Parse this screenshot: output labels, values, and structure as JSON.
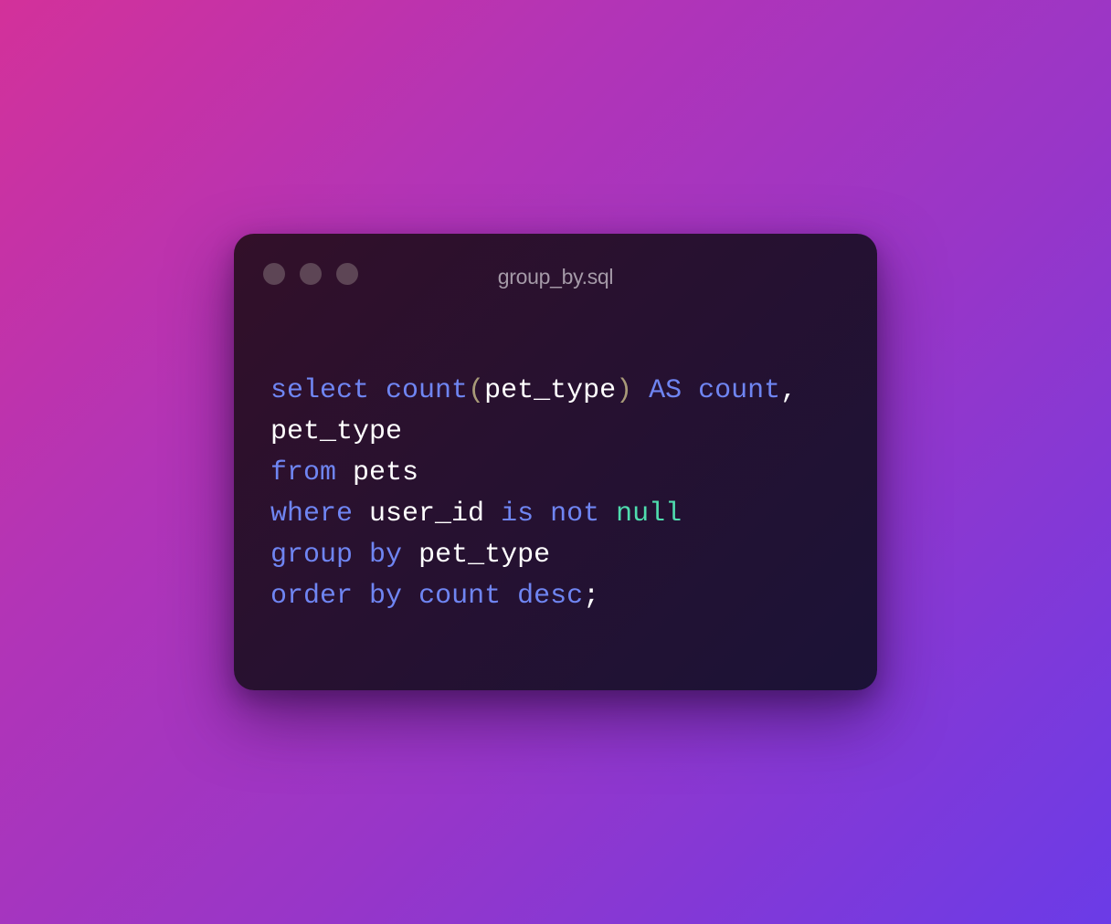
{
  "window": {
    "title": "group_by.sql",
    "traffic_lights": [
      "close-dot",
      "minimize-dot",
      "maximize-dot"
    ]
  },
  "colors": {
    "keyword": "#6f85f2",
    "identifier": "#ffffff",
    "paren": "#a89a78",
    "literal": "#4fdcae",
    "title": "#a59aa8",
    "window_bg": "#271130"
  },
  "code": {
    "lines": [
      [
        {
          "t": "select",
          "k": "kw"
        },
        {
          "t": " ",
          "k": "id"
        },
        {
          "t": "count",
          "k": "fn"
        },
        {
          "t": "(",
          "k": "paren"
        },
        {
          "t": "pet_type",
          "k": "id"
        },
        {
          "t": ")",
          "k": "paren"
        },
        {
          "t": " ",
          "k": "id"
        },
        {
          "t": "AS",
          "k": "kw"
        },
        {
          "t": " ",
          "k": "id"
        },
        {
          "t": "count",
          "k": "kw"
        },
        {
          "t": ",",
          "k": "punc"
        }
      ],
      [
        {
          "t": "pet_type",
          "k": "id"
        }
      ],
      [
        {
          "t": "from",
          "k": "kw"
        },
        {
          "t": " ",
          "k": "id"
        },
        {
          "t": "pets",
          "k": "id"
        }
      ],
      [
        {
          "t": "where",
          "k": "kw"
        },
        {
          "t": " ",
          "k": "id"
        },
        {
          "t": "user_id",
          "k": "id"
        },
        {
          "t": " ",
          "k": "id"
        },
        {
          "t": "is",
          "k": "kw"
        },
        {
          "t": " ",
          "k": "id"
        },
        {
          "t": "not",
          "k": "kw"
        },
        {
          "t": " ",
          "k": "id"
        },
        {
          "t": "null",
          "k": "lit"
        }
      ],
      [
        {
          "t": "group",
          "k": "kw"
        },
        {
          "t": " ",
          "k": "id"
        },
        {
          "t": "by",
          "k": "kw"
        },
        {
          "t": " ",
          "k": "id"
        },
        {
          "t": "pet_type",
          "k": "id"
        }
      ],
      [
        {
          "t": "order",
          "k": "kw"
        },
        {
          "t": " ",
          "k": "id"
        },
        {
          "t": "by",
          "k": "kw"
        },
        {
          "t": " ",
          "k": "id"
        },
        {
          "t": "count",
          "k": "kw"
        },
        {
          "t": " ",
          "k": "id"
        },
        {
          "t": "desc",
          "k": "kw"
        },
        {
          "t": ";",
          "k": "punc"
        }
      ]
    ]
  }
}
